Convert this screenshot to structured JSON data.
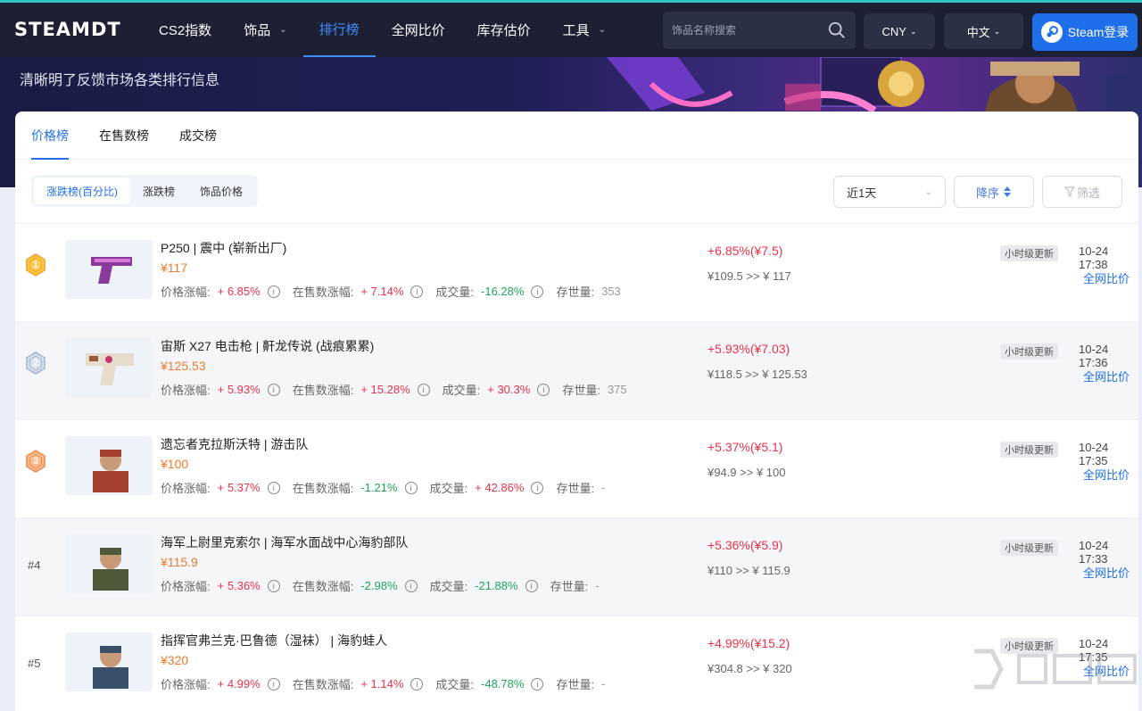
{
  "header": {
    "logo": "STEAMDT",
    "nav": [
      {
        "label": "CS2指数",
        "dropdown": false,
        "active": false
      },
      {
        "label": "饰品",
        "dropdown": true,
        "active": false
      },
      {
        "label": "排行榜",
        "dropdown": false,
        "active": true
      },
      {
        "label": "全网比价",
        "dropdown": false,
        "active": false
      },
      {
        "label": "库存估价",
        "dropdown": false,
        "active": false
      },
      {
        "label": "工具",
        "dropdown": true,
        "active": false
      }
    ],
    "search_placeholder": "饰品名称搜索",
    "currency": "CNY",
    "language": "中文",
    "login_label": "Steam登录"
  },
  "banner": {
    "subtitle": "清晰明了反馈市场各类排行信息"
  },
  "tabs": [
    {
      "label": "价格榜",
      "active": true
    },
    {
      "label": "在售数榜",
      "active": false
    },
    {
      "label": "成交榜",
      "active": false
    }
  ],
  "filters": {
    "segments": [
      {
        "label": "涨跌榜(百分比)",
        "active": true
      },
      {
        "label": "涨跌榜",
        "active": false
      },
      {
        "label": "饰品价格",
        "active": false
      }
    ],
    "period": "近1天",
    "sort": "降序",
    "filter": "筛选"
  },
  "labels": {
    "price_change": "价格涨幅:",
    "listing_change": "在售数涨幅:",
    "volume": "成交量:",
    "stock": "存世量:",
    "update_badge": "小时级更新",
    "compare": "全网比价"
  },
  "items": [
    {
      "rank": "1",
      "rank_type": "gold",
      "name": "P250 | 震中 (崭新出厂)",
      "price": "¥117",
      "price_change": "+ 6.85%",
      "pc_dir": "up",
      "listing_change": "+ 7.14%",
      "lc_dir": "up",
      "volume": "-16.28%",
      "vol_dir": "down",
      "stock": "353",
      "change": "+6.85%(¥7.5)",
      "range": "¥109.5  >>  ¥ 117",
      "time": "10-24 17:38",
      "thumb": "pistol-purple"
    },
    {
      "rank": "2",
      "rank_type": "silver",
      "name": "宙斯 X27 电击枪 | 鼾龙传说 (战痕累累)",
      "price": "¥125.53",
      "price_change": "+ 5.93%",
      "pc_dir": "up",
      "listing_change": "+ 15.28%",
      "lc_dir": "up",
      "volume": "+ 30.3%",
      "vol_dir": "up",
      "stock": "375",
      "change": "+5.93%(¥7.03)",
      "range": "¥118.5  >>  ¥ 125.53",
      "time": "10-24 17:36",
      "thumb": "zeus"
    },
    {
      "rank": "3",
      "rank_type": "bronze",
      "name": "遗忘者克拉斯沃特 | 游击队",
      "price": "¥100",
      "price_change": "+ 5.37%",
      "pc_dir": "up",
      "listing_change": "-1.21%",
      "lc_dir": "down",
      "volume": "+ 42.86%",
      "vol_dir": "up",
      "stock": "-",
      "change": "+5.37%(¥5.1)",
      "range": "¥94.9  >>  ¥ 100",
      "time": "10-24 17:35",
      "thumb": "agent-red"
    },
    {
      "rank": "#4",
      "rank_type": "text",
      "name": "海军上尉里克索尔 | 海军水面战中心海豹部队",
      "price": "¥115.9",
      "price_change": "+ 5.36%",
      "pc_dir": "up",
      "listing_change": "-2.98%",
      "lc_dir": "down",
      "volume": "-21.88%",
      "vol_dir": "down",
      "stock": "-",
      "change": "+5.36%(¥5.9)",
      "range": "¥110  >>  ¥ 115.9",
      "time": "10-24 17:33",
      "thumb": "agent-green"
    },
    {
      "rank": "#5",
      "rank_type": "text",
      "name": "指挥官弗兰克·巴鲁德（湿袜） | 海豹蛙人",
      "price": "¥320",
      "price_change": "+ 4.99%",
      "pc_dir": "up",
      "listing_change": "+ 1.14%",
      "lc_dir": "up",
      "volume": "-48.78%",
      "vol_dir": "down",
      "stock": "-",
      "change": "+4.99%(¥15.2)",
      "range": "¥304.8  >>  ¥ 320",
      "time": "10-24 17:35",
      "thumb": "agent-blue"
    }
  ],
  "colors": {
    "accent": "#1f6fea",
    "up": "#e8334a",
    "down": "#1fa45b",
    "price": "#f07a2c",
    "topbar": "#1d2033",
    "teal_line": "#2ec6c0"
  }
}
